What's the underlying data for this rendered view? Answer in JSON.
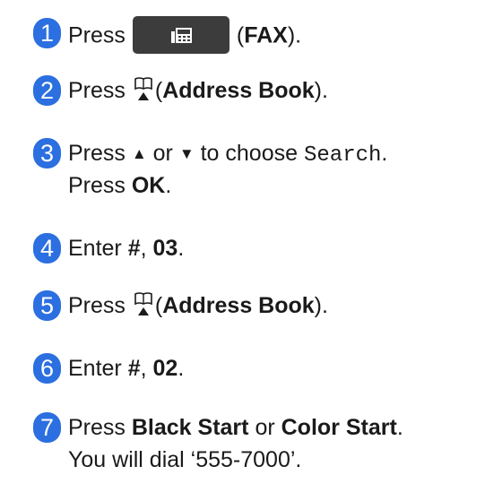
{
  "accent_color": "#2b6fe0",
  "steps": [
    {
      "number": "1",
      "t1": "Press",
      "t2": "(",
      "t3": "FAX",
      "t4": ")."
    },
    {
      "number": "2",
      "t1": "Press",
      "t2": "(",
      "t3": "Address Book",
      "t4": ")."
    },
    {
      "number": "3",
      "t1": "Press",
      "t2": "▲",
      "t3": "or",
      "t4": "▼",
      "t5": "to choose",
      "t6": "Search",
      "t7": ".",
      "l2a": "Press",
      "l2b": "OK",
      "l2c": "."
    },
    {
      "number": "4",
      "t1": "Enter",
      "t2": "#",
      "t3": ",",
      "t4": "03",
      "t5": "."
    },
    {
      "number": "5",
      "t1": "Press",
      "t2": "(",
      "t3": "Address Book",
      "t4": ")."
    },
    {
      "number": "6",
      "t1": "Enter",
      "t2": "#",
      "t3": ",",
      "t4": "02",
      "t5": "."
    },
    {
      "number": "7",
      "t1": "Press",
      "t2": "Black Start",
      "t3": "or",
      "t4": "Color Start",
      "t5": ".",
      "l2": "You will dial ‘555-7000’."
    }
  ],
  "icons": {
    "fax": "fax-icon",
    "address_book": "address-book-icon"
  }
}
